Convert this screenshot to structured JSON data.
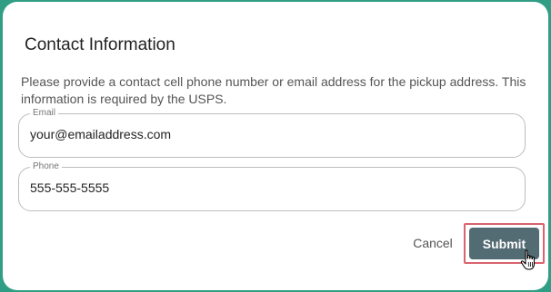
{
  "dialog": {
    "title": "Contact Information",
    "description": "Please provide a contact cell phone number or email address for the pickup address. This information is required by the USPS."
  },
  "fields": {
    "email": {
      "label": "Email",
      "value": "your@emailaddress.com"
    },
    "phone": {
      "label": "Phone",
      "value": "555-555-5555"
    }
  },
  "actions": {
    "cancel_label": "Cancel",
    "submit_label": "Submit"
  },
  "colors": {
    "backdrop": "#2f9e84",
    "submit_bg": "#536b73",
    "highlight_border": "#d9636e"
  },
  "icons": {
    "cursor": "hand-pointer-icon"
  }
}
